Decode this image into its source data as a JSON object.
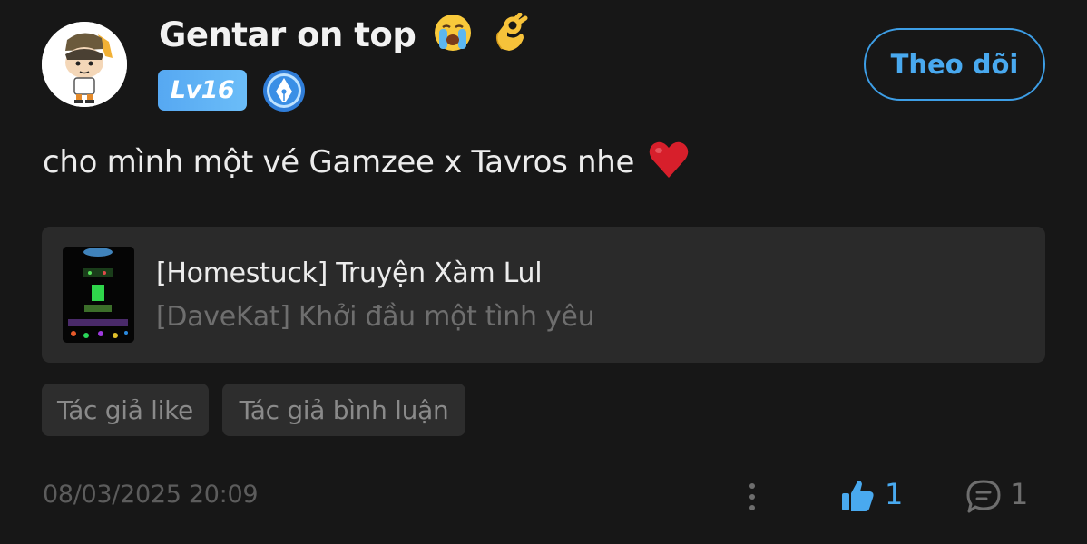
{
  "post": {
    "username": "Gentar on top",
    "level_badge": "Lv16",
    "follow_label": "Theo dõi",
    "comment_text": "cho mình một vé Gamzee x Tavros nhe"
  },
  "story": {
    "title": "[Homestuck] Truyện Xàm Lul",
    "chapter": "[DaveKat] Khởi đầu một tình yêu"
  },
  "tags": [
    "Tác giả like",
    "Tác giả bình luận"
  ],
  "footer": {
    "timestamp": "08/03/2025 20:09",
    "like_count": "1",
    "comment_count": "1"
  },
  "icons": {
    "username_emojis": [
      "crying-face-icon",
      "ok-hand-icon"
    ],
    "comment_emoji": "heart-icon",
    "writer_badge": "pen-nib-icon",
    "actions": [
      "more-vertical-icon",
      "thumbs-up-icon",
      "comment-icon"
    ]
  },
  "colors": {
    "background": "#171717",
    "accent": "#49a9ef",
    "card": "#2a2a2a",
    "tag": "#2d2d2d",
    "heart": "#d71f2b"
  }
}
